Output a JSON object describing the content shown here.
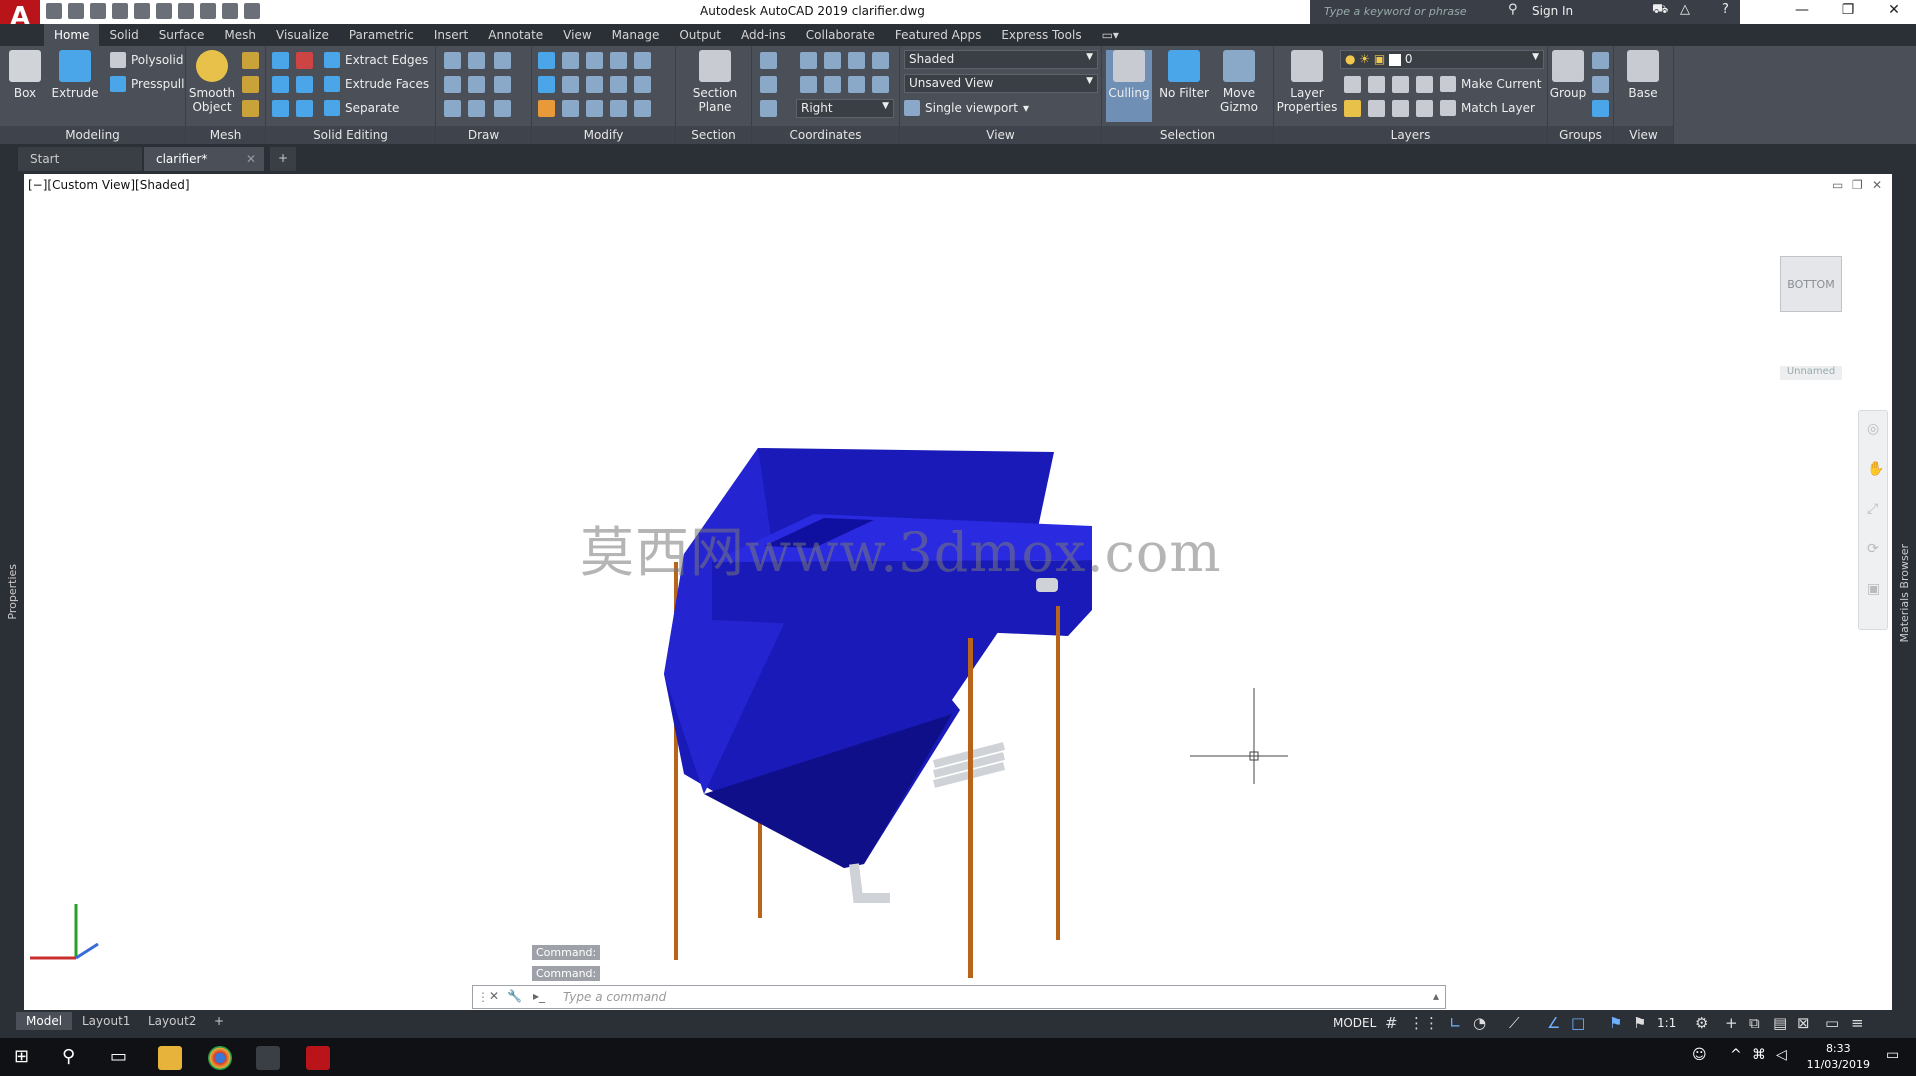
{
  "app": {
    "logo_letter": "A",
    "title": "Autodesk AutoCAD 2019    clarifier.dwg"
  },
  "search": {
    "placeholder": "Type a keyword or phrase"
  },
  "account": {
    "sign_in": "Sign In"
  },
  "ribbon_tabs": [
    "Home",
    "Solid",
    "Surface",
    "Mesh",
    "Visualize",
    "Parametric",
    "Insert",
    "Annotate",
    "View",
    "Manage",
    "Output",
    "Add-ins",
    "Collaborate",
    "Featured Apps",
    "Express Tools"
  ],
  "ribbon": {
    "modeling": {
      "box": "Box",
      "extrude": "Extrude",
      "polysolid": "Polysolid",
      "presspull": "Presspull",
      "label": "Modeling"
    },
    "mesh": {
      "smooth_object": "Smooth Object",
      "label": "Mesh"
    },
    "solid_editing": {
      "extract_edges": "Extract Edges",
      "extrude_faces": "Extrude Faces",
      "separate": "Separate",
      "label": "Solid Editing"
    },
    "draw": {
      "label": "Draw"
    },
    "modify": {
      "label": "Modify"
    },
    "section": {
      "section_plane": "Section Plane",
      "label": "Section"
    },
    "coordinates": {
      "ucs_value": "Right",
      "label": "Coordinates"
    },
    "view": {
      "visual_style": "Shaded",
      "saved_view": "Unsaved View",
      "viewport": "Single viewport",
      "label": "View"
    },
    "selection": {
      "culling": "Culling",
      "no_filter": "No Filter",
      "move_gizmo": "Move Gizmo",
      "label": "Selection"
    },
    "layers": {
      "layer_properties": "Layer Properties",
      "current_layer": "0",
      "make_current": "Make Current",
      "match_layer": "Match Layer",
      "label": "Layers"
    },
    "groups": {
      "group": "Group",
      "label": "Groups"
    },
    "view2": {
      "base": "Base",
      "label": "View"
    }
  },
  "doc_tabs": {
    "start": "Start",
    "active": "clarifier*"
  },
  "viewport": {
    "label": "[−][Custom View][Shaded]"
  },
  "viewcube": {
    "face": "BOTTOM",
    "ucs_name": "Unnamed"
  },
  "side_panels": {
    "left": "Properties",
    "right": "Materials Browser"
  },
  "watermark": "莫西网www.3dmox.com",
  "command": {
    "history": [
      "Command:",
      "Command:"
    ],
    "placeholder": "Type a command"
  },
  "layout_tabs": [
    "Model",
    "Layout1",
    "Layout2"
  ],
  "status": {
    "space": "MODEL",
    "scale": "1:1"
  },
  "clock": {
    "time": "8:33",
    "date": "11/03/2019"
  },
  "colors": {
    "accent_red": "#b8141a",
    "model_blue": "#1a1ab8",
    "leg_orange": "#b8641a",
    "ribbon": "#4a4f58"
  }
}
